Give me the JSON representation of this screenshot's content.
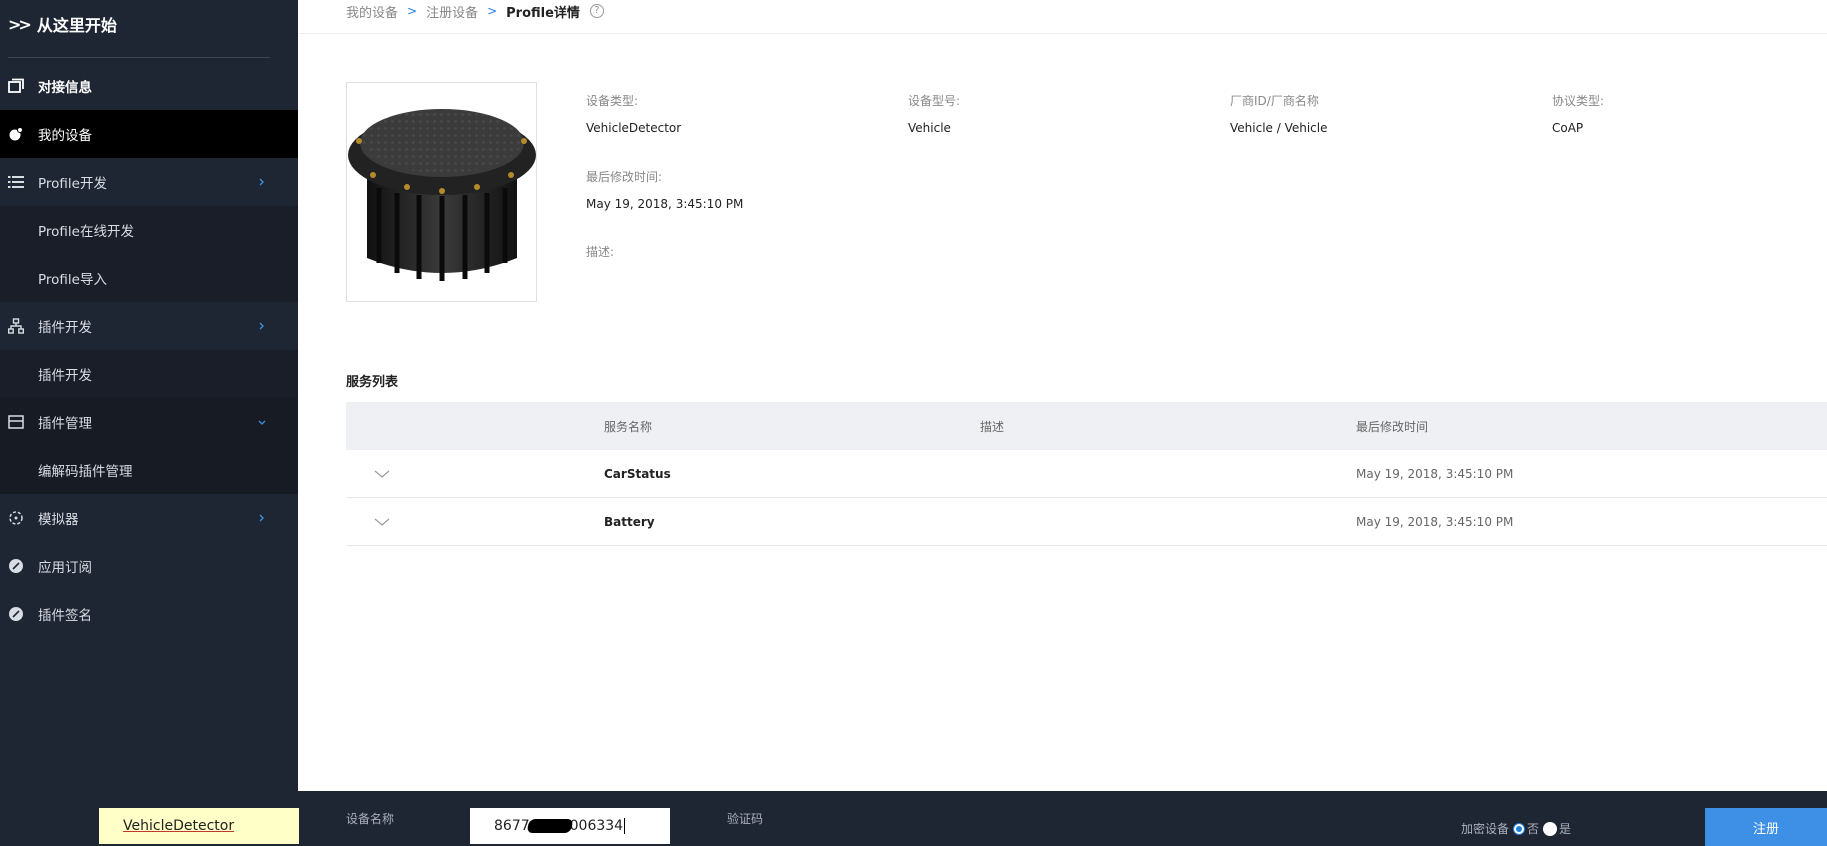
{
  "sidebar": {
    "brand": "从这里开始",
    "items": [
      {
        "label": "对接信息",
        "icon": "window-icon"
      },
      {
        "label": "我的设备",
        "icon": "device-icon"
      },
      {
        "label": "Profile开发",
        "icon": "list-icon"
      },
      {
        "label": "Profile在线开发"
      },
      {
        "label": "Profile导入"
      },
      {
        "label": "插件开发",
        "icon": "hierarchy-icon"
      },
      {
        "label": "插件开发"
      },
      {
        "label": "插件管理",
        "icon": "panel-icon"
      },
      {
        "label": "编解码插件管理"
      },
      {
        "label": "模拟器",
        "icon": "simulator-icon"
      },
      {
        "label": "应用订阅",
        "icon": "leaf-icon"
      },
      {
        "label": "插件签名",
        "icon": "leaf-icon"
      }
    ]
  },
  "breadcrumb": {
    "items": [
      "我的设备",
      "注册设备"
    ],
    "current": "Profile详情",
    "help": "?"
  },
  "device": {
    "type_label": "设备类型:",
    "type_value": "VehicleDetector",
    "model_label": "设备型号:",
    "model_value": "Vehicle",
    "vendor_label": "厂商ID/厂商名称",
    "vendor_value": "Vehicle / Vehicle",
    "protocol_label": "协议类型:",
    "protocol_value": "CoAP",
    "modified_label": "最后修改时间:",
    "modified_value": "May 19, 2018, 3:45:10 PM",
    "desc_label": "描述:"
  },
  "services": {
    "title": "服务列表",
    "headers": [
      "服务名称",
      "描述",
      "最后修改时间"
    ],
    "rows": [
      {
        "name": "CarStatus",
        "desc": "",
        "time": "May 19, 2018, 3:45:10 PM"
      },
      {
        "name": "Battery",
        "desc": "",
        "time": "May 19, 2018, 3:45:10 PM"
      }
    ]
  },
  "footer": {
    "name_label": "设备名称",
    "name_value": "VehicleDetector",
    "code_label": "验证码",
    "code_prefix": "8677",
    "code_suffix": "006334",
    "encrypt_label": "加密设备",
    "opt_no": "否",
    "opt_yes": "是",
    "register_label": "注册"
  },
  "colors": {
    "sidebar_bg": "#1f2633",
    "accent": "#3e8fe6"
  }
}
